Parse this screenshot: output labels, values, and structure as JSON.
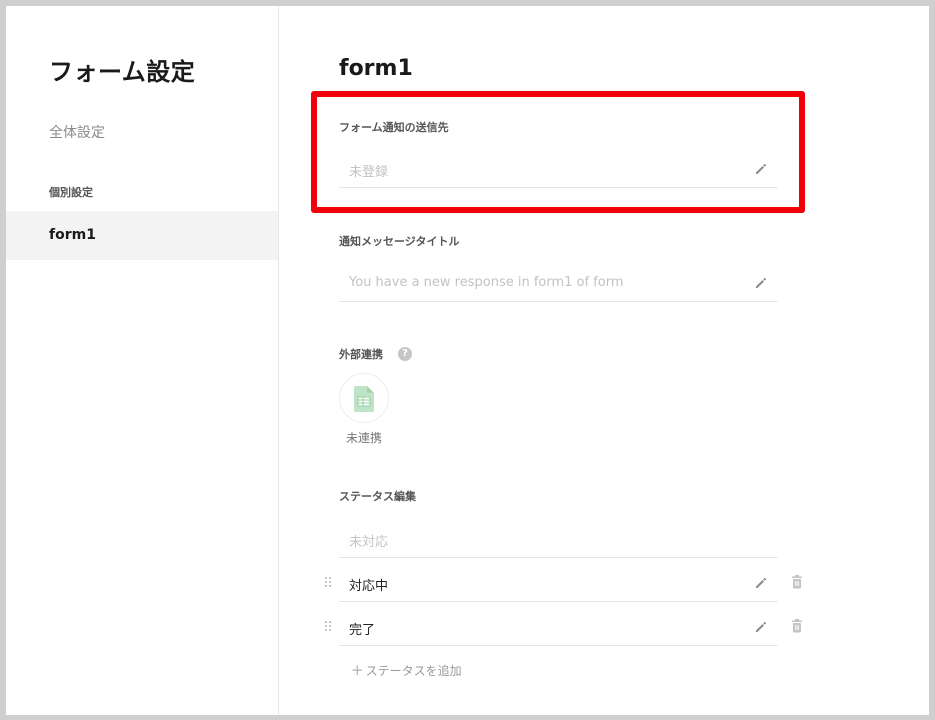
{
  "sidebar": {
    "title": "フォーム設定",
    "general_label": "全体設定",
    "section_label": "個別設定",
    "items": [
      {
        "label": "form1"
      }
    ]
  },
  "main": {
    "title": "form1",
    "notify_recipient": {
      "label": "フォーム通知の送信先",
      "value": "未登録"
    },
    "notify_title": {
      "label": "通知メッセージタイトル",
      "placeholder": "You have a new response in form1 of form"
    },
    "integration": {
      "label": "外部連携",
      "help": "?",
      "status": "未連携"
    },
    "status_edit": {
      "label": "ステータス編集",
      "default_status": "未対応",
      "statuses": [
        {
          "label": "対応中"
        },
        {
          "label": "完了"
        }
      ],
      "add_label": "ステータスを追加",
      "add_icon": "+"
    }
  },
  "colors": {
    "highlight": "#f2000a",
    "sheet_icon": "#7cc48a"
  }
}
